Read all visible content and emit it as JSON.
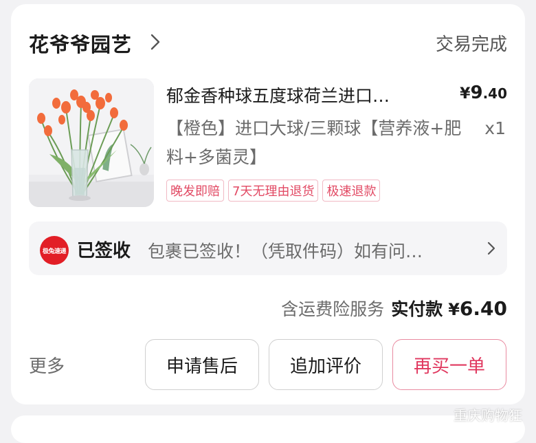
{
  "shop": {
    "name": "花爷爷园艺",
    "status": "交易完成"
  },
  "product": {
    "title": "郁金香种球五度球荷兰进口…",
    "price_currency": "¥",
    "price_int": "9",
    "price_dec": ".40",
    "spec": "【橙色】进口大球/三颗球【营养液+肥料+多菌灵】",
    "quantity": "x1",
    "tags": [
      "晚发即赔",
      "7天无理由退货",
      "极速退款"
    ]
  },
  "logistics": {
    "courier_logo_text": "极兔速递",
    "status": "已签收",
    "detail": "包裹已签收！（凭取件码）如有问…"
  },
  "payment": {
    "insurance": "含运费险服务",
    "label": "实付款",
    "currency": "¥",
    "amount": "6.40"
  },
  "actions": {
    "more": "更多",
    "aftersale": "申请售后",
    "add_review": "追加评价",
    "buy_again": "再买一单"
  },
  "watermark": "重庆购物狂",
  "colors": {
    "accent": "#e0375e",
    "tag_border": "#f1b9c4",
    "courier_red": "#e21e26"
  }
}
